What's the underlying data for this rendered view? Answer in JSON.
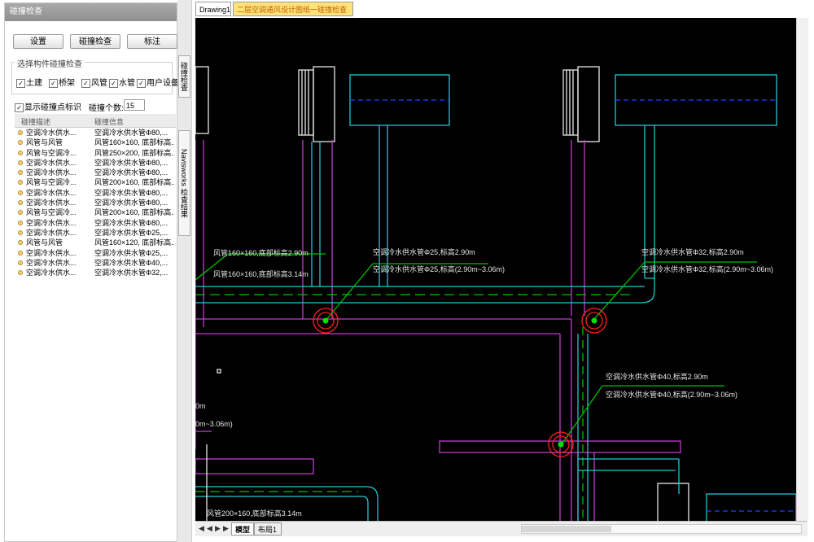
{
  "panel": {
    "title": "碰撞检查",
    "buttons": {
      "settings": "设置",
      "check": "碰撞检查",
      "mark": "标注"
    },
    "group_title": "选择构件碰撞检查",
    "checkboxes": [
      {
        "label": "土建",
        "checked": true
      },
      {
        "label": "桥架",
        "checked": true
      },
      {
        "label": "风管",
        "checked": true
      },
      {
        "label": "水管",
        "checked": true
      },
      {
        "label": "用户设备",
        "checked": true
      }
    ],
    "show_marks": {
      "label": "显示碰撞点标识",
      "checked": true
    },
    "count_label": "碰撞个数:",
    "count_value": "15",
    "table": {
      "headers": [
        "碰撞描述",
        "碰撞信息"
      ],
      "rows": [
        [
          "空调冷水供水...",
          "空调冷水供水管Φ80,..."
        ],
        [
          "风管与风管",
          "风管160×160, 底部标高..."
        ],
        [
          "风管与空调冷...",
          "风管250×200, 底部标高..."
        ],
        [
          "空调冷水供水...",
          "空调冷水供水管Φ80,..."
        ],
        [
          "空调冷水供水...",
          "空调冷水供水管Φ80,..."
        ],
        [
          "风管与空调冷...",
          "风管200×160, 底部标高..."
        ],
        [
          "空调冷水供水...",
          "空调冷水供水管Φ80,..."
        ],
        [
          "空调冷水供水...",
          "空调冷水供水管Φ80,..."
        ],
        [
          "风管与空调冷...",
          "风管200×160, 底部标高..."
        ],
        [
          "空调冷水供水...",
          "空调冷水供水管Φ80,..."
        ],
        [
          "空调冷水供水...",
          "空调冷水供水管Φ25,..."
        ],
        [
          "风管与风管",
          "风管160×120, 底部标高..."
        ],
        [
          "空调冷水供水...",
          "空调冷水供水管Φ25,..."
        ],
        [
          "空调冷水供水...",
          "空调冷水供水管Φ40,..."
        ],
        [
          "空调冷水供水...",
          "空调冷水供水管Φ32,..."
        ]
      ]
    }
  },
  "side_tabs": [
    "碰撞检查",
    "Navisworks 检查结果"
  ],
  "doc_tabs": [
    "Drawing1",
    "二层空调通风设计图纸一碰撞检查"
  ],
  "layout_tabs": [
    "模型",
    "布局1"
  ],
  "cad_labels": {
    "l1a": "空调冷水供水管Φ25,标高2.90m",
    "l1b": "空调冷水供水管Φ25,标高(2.90m~3.06m)",
    "l2a": "空调冷水供水管Φ32,标高2.90m",
    "l2b": "空调冷水供水管Φ32,标高(2.90m~3.06m)",
    "l3a": "空调冷水供水管Φ40,标高2.90m",
    "l3b": "空调冷水供水管Φ40,标高(2.90m~3.06m)",
    "l4a": "风管160×160,底部标高2.90m",
    "l4b": "风管160×160,底部标高3.14m",
    "l5": "风管200×160,底部标高3.14m",
    "l6a": "0m",
    "l6b": "0m~3.06m)"
  },
  "colors": {
    "cad_background": "#000000",
    "pipe_cyan": "#22c6d6",
    "duct_magenta": "#c23bd1",
    "leader_green": "#00c000",
    "clash_red": "#ff2020",
    "active_tab": "#ffe27a"
  }
}
